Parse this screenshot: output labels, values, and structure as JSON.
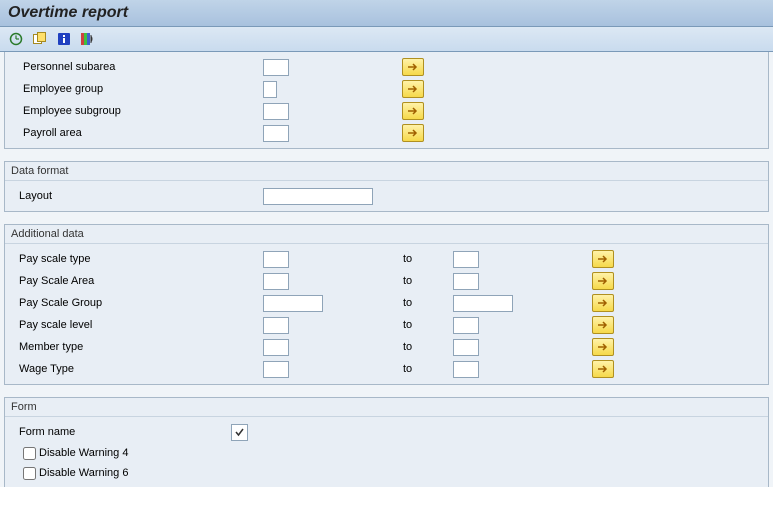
{
  "title": "Overtime report",
  "top_section": {
    "rows": [
      {
        "label": "Personnel subarea"
      },
      {
        "label": "Employee group"
      },
      {
        "label": "Employee subgroup"
      },
      {
        "label": "Payroll area"
      }
    ]
  },
  "data_format": {
    "title": "Data format",
    "layout_label": "Layout"
  },
  "additional_data": {
    "title": "Additional data",
    "to_label": "to",
    "rows": [
      {
        "label": "Pay scale type",
        "size": "sm"
      },
      {
        "label": "Pay Scale Area",
        "size": "sm"
      },
      {
        "label": "Pay Scale Group",
        "size": "md"
      },
      {
        "label": "Pay scale level",
        "size": "sm"
      },
      {
        "label": "Member type",
        "size": "sm"
      },
      {
        "label": "Wage Type",
        "size": "sm"
      }
    ]
  },
  "form_section": {
    "title": "Form",
    "form_name_label": "Form name",
    "checks": [
      {
        "label": "Disable Warning 4"
      },
      {
        "label": "Disable Warning 6"
      }
    ]
  }
}
